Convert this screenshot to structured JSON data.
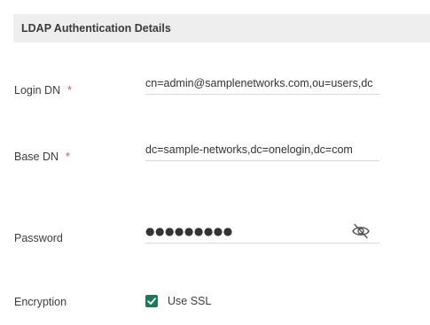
{
  "section": {
    "title": "LDAP Authentication Details"
  },
  "login_dn": {
    "label": "Login DN",
    "required_mark": "*",
    "value": "cn=admin@samplenetworks.com,ou=users,dc"
  },
  "base_dn": {
    "label": "Base DN",
    "required_mark": "*",
    "value": "dc=sample-networks,dc=onelogin,dc=com"
  },
  "password": {
    "label": "Password",
    "masked_value": "●●●●●●●●●",
    "toggle_icon": "eye-slash-icon"
  },
  "encryption": {
    "label": "Encryption",
    "checkbox_label": "Use SSL",
    "checked": true,
    "checkbox_color": "#1a7a54"
  }
}
